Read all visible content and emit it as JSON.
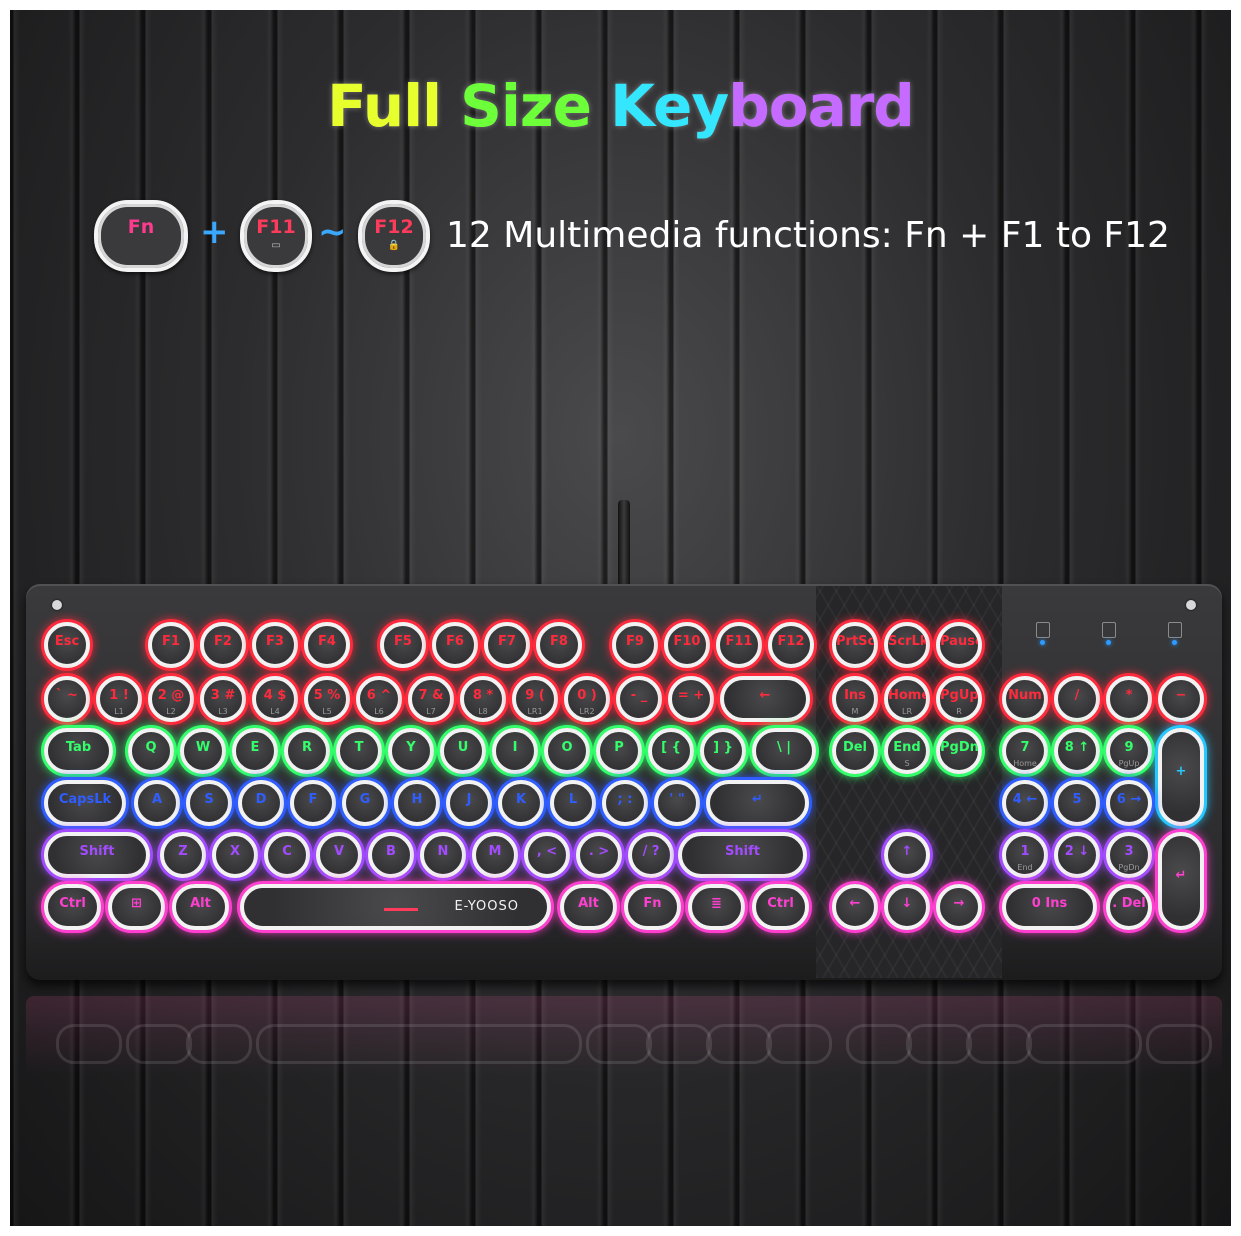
{
  "headline": {
    "parts": [
      {
        "text": "Full",
        "color": "#e8ff2e"
      },
      {
        "text": "Size",
        "color": "#6dff3a"
      },
      {
        "text": "Key",
        "color": "#35e6ff"
      },
      {
        "text": "board",
        "color": "#c56bff"
      }
    ]
  },
  "multimedia": {
    "key_fn": "Fn",
    "plus": "+",
    "key_f11": "F11",
    "tilde": "~",
    "key_f12": "F12",
    "caption": "12 Multimedia functions: Fn + F1 to F12"
  },
  "keyboard": {
    "brand": "E-YOOSO",
    "colors": {
      "red": "#ff2a3c",
      "green": "#32ff6a",
      "cyan": "#26c8ff",
      "blue": "#2f5dff",
      "purple": "#a24bff",
      "magenta": "#ff3fd0"
    },
    "keys": [
      {
        "label": "Esc",
        "row": 0,
        "glow": "red"
      },
      {
        "label": "F1",
        "row": 0,
        "glow": "red"
      },
      {
        "label": "F2",
        "row": 0,
        "glow": "red"
      },
      {
        "label": "F3",
        "row": 0,
        "glow": "red"
      },
      {
        "label": "F4",
        "row": 0,
        "glow": "red"
      },
      {
        "label": "F5",
        "row": 0,
        "glow": "red"
      },
      {
        "label": "F6",
        "row": 0,
        "glow": "red"
      },
      {
        "label": "F7",
        "row": 0,
        "glow": "red"
      },
      {
        "label": "F8",
        "row": 0,
        "glow": "red"
      },
      {
        "label": "F9",
        "row": 0,
        "glow": "red"
      },
      {
        "label": "F10",
        "row": 0,
        "glow": "red"
      },
      {
        "label": "F11",
        "row": 0,
        "glow": "red"
      },
      {
        "label": "F12",
        "row": 0,
        "glow": "red"
      },
      {
        "label": "PrtSc",
        "row": 0,
        "glow": "red"
      },
      {
        "label": "ScrLk",
        "row": 0,
        "glow": "red"
      },
      {
        "label": "Pause",
        "row": 0,
        "glow": "red"
      },
      {
        "label": "` ~",
        "row": 1,
        "glow": "red"
      },
      {
        "label": "1 !",
        "sub": "L1",
        "row": 1,
        "glow": "red"
      },
      {
        "label": "2 @",
        "sub": "L2",
        "row": 1,
        "glow": "red"
      },
      {
        "label": "3 #",
        "sub": "L3",
        "row": 1,
        "glow": "red"
      },
      {
        "label": "4 $",
        "sub": "L4",
        "row": 1,
        "glow": "red"
      },
      {
        "label": "5 %",
        "sub": "L5",
        "row": 1,
        "glow": "red"
      },
      {
        "label": "6 ^",
        "sub": "L6",
        "row": 1,
        "glow": "red"
      },
      {
        "label": "7 &",
        "sub": "L7",
        "row": 1,
        "glow": "red"
      },
      {
        "label": "8 *",
        "sub": "L8",
        "row": 1,
        "glow": "red"
      },
      {
        "label": "9 (",
        "sub": "LR1",
        "row": 1,
        "glow": "red"
      },
      {
        "label": "0 )",
        "sub": "LR2",
        "row": 1,
        "glow": "red"
      },
      {
        "label": "- _",
        "row": 1,
        "glow": "red"
      },
      {
        "label": "= +",
        "row": 1,
        "glow": "red"
      },
      {
        "label": "←",
        "row": 1,
        "glow": "red"
      },
      {
        "label": "Ins",
        "sub": "M",
        "row": 1,
        "glow": "red"
      },
      {
        "label": "Home",
        "sub": "LR",
        "row": 1,
        "glow": "red"
      },
      {
        "label": "PgUp",
        "sub": "R",
        "row": 1,
        "glow": "red"
      },
      {
        "label": "Num",
        "row": 1,
        "glow": "red"
      },
      {
        "label": "/",
        "row": 1,
        "glow": "red"
      },
      {
        "label": "*",
        "row": 1,
        "glow": "red"
      },
      {
        "label": "−",
        "row": 1,
        "glow": "red"
      },
      {
        "label": "Tab",
        "row": 2,
        "glow": "green"
      },
      {
        "label": "Q",
        "row": 2,
        "glow": "green"
      },
      {
        "label": "W",
        "row": 2,
        "glow": "green"
      },
      {
        "label": "E",
        "row": 2,
        "glow": "green"
      },
      {
        "label": "R",
        "row": 2,
        "glow": "green"
      },
      {
        "label": "T",
        "row": 2,
        "glow": "green"
      },
      {
        "label": "Y",
        "row": 2,
        "glow": "green"
      },
      {
        "label": "U",
        "row": 2,
        "glow": "green"
      },
      {
        "label": "I",
        "row": 2,
        "glow": "green"
      },
      {
        "label": "O",
        "row": 2,
        "glow": "green"
      },
      {
        "label": "P",
        "row": 2,
        "glow": "green"
      },
      {
        "label": "[ {",
        "row": 2,
        "glow": "green"
      },
      {
        "label": "] }",
        "row": 2,
        "glow": "green"
      },
      {
        "label": "\\ |",
        "row": 2,
        "glow": "green"
      },
      {
        "label": "Del",
        "row": 2,
        "glow": "green"
      },
      {
        "label": "End",
        "sub": "S",
        "row": 2,
        "glow": "green"
      },
      {
        "label": "PgDn",
        "row": 2,
        "glow": "green"
      },
      {
        "label": "7",
        "sub": "Home",
        "row": 2,
        "glow": "green"
      },
      {
        "label": "8 ↑",
        "row": 2,
        "glow": "green"
      },
      {
        "label": "9",
        "sub": "PgUp",
        "row": 2,
        "glow": "green"
      },
      {
        "label": "+",
        "row": 2,
        "glow": "cyan"
      },
      {
        "label": "CapsLk",
        "row": 3,
        "glow": "blue"
      },
      {
        "label": "A",
        "row": 3,
        "glow": "blue"
      },
      {
        "label": "S",
        "row": 3,
        "glow": "blue"
      },
      {
        "label": "D",
        "row": 3,
        "glow": "blue"
      },
      {
        "label": "F",
        "row": 3,
        "glow": "blue"
      },
      {
        "label": "G",
        "row": 3,
        "glow": "blue"
      },
      {
        "label": "H",
        "row": 3,
        "glow": "blue"
      },
      {
        "label": "J",
        "row": 3,
        "glow": "blue"
      },
      {
        "label": "K",
        "row": 3,
        "glow": "blue"
      },
      {
        "label": "L",
        "row": 3,
        "glow": "blue"
      },
      {
        "label": "; :",
        "row": 3,
        "glow": "blue"
      },
      {
        "label": "' \"",
        "row": 3,
        "glow": "blue"
      },
      {
        "label": "↵",
        "row": 3,
        "glow": "blue"
      },
      {
        "label": "4 ←",
        "row": 3,
        "glow": "blue"
      },
      {
        "label": "5",
        "row": 3,
        "glow": "blue"
      },
      {
        "label": "6 →",
        "row": 3,
        "glow": "blue"
      },
      {
        "label": "Shift",
        "row": 4,
        "glow": "purple"
      },
      {
        "label": "Z",
        "row": 4,
        "glow": "purple"
      },
      {
        "label": "X",
        "row": 4,
        "glow": "purple"
      },
      {
        "label": "C",
        "row": 4,
        "glow": "purple"
      },
      {
        "label": "V",
        "row": 4,
        "glow": "purple"
      },
      {
        "label": "B",
        "row": 4,
        "glow": "purple"
      },
      {
        "label": "N",
        "row": 4,
        "glow": "purple"
      },
      {
        "label": "M",
        "row": 4,
        "glow": "purple"
      },
      {
        "label": ", <",
        "row": 4,
        "glow": "purple"
      },
      {
        "label": ". >",
        "row": 4,
        "glow": "purple"
      },
      {
        "label": "/ ?",
        "row": 4,
        "glow": "purple"
      },
      {
        "label": "Shift",
        "row": 4,
        "glow": "purple"
      },
      {
        "label": "↑",
        "row": 4,
        "glow": "purple"
      },
      {
        "label": "1",
        "sub": "End",
        "row": 4,
        "glow": "purple"
      },
      {
        "label": "2 ↓",
        "row": 4,
        "glow": "purple"
      },
      {
        "label": "3",
        "sub": "PgDn",
        "row": 4,
        "glow": "purple"
      },
      {
        "label": "↵",
        "row": 4,
        "glow": "magenta"
      },
      {
        "label": "Ctrl",
        "row": 5,
        "glow": "magenta"
      },
      {
        "label": "⊞",
        "row": 5,
        "glow": "magenta"
      },
      {
        "label": "Alt",
        "row": 5,
        "glow": "magenta"
      },
      {
        "label": "E-YOOSO",
        "row": 5,
        "glow": "magenta"
      },
      {
        "label": "Alt",
        "row": 5,
        "glow": "magenta"
      },
      {
        "label": "Fn",
        "row": 5,
        "glow": "magenta"
      },
      {
        "label": "≣",
        "row": 5,
        "glow": "magenta"
      },
      {
        "label": "Ctrl",
        "row": 5,
        "glow": "magenta"
      },
      {
        "label": "←",
        "row": 5,
        "glow": "magenta"
      },
      {
        "label": "↓",
        "row": 5,
        "glow": "magenta"
      },
      {
        "label": "→",
        "row": 5,
        "glow": "magenta"
      },
      {
        "label": "0 Ins",
        "row": 5,
        "glow": "magenta"
      },
      {
        "label": ". Del",
        "row": 5,
        "glow": "magenta"
      }
    ]
  }
}
